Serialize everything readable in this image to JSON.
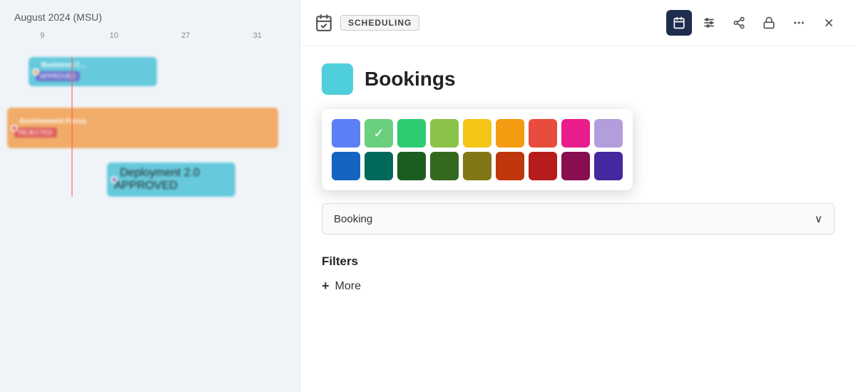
{
  "header": {
    "calendar_icon": "📅",
    "scheduling_label": "SCHEDULING",
    "icons": [
      {
        "name": "calendar-view-icon",
        "symbol": "📅",
        "active": true
      },
      {
        "name": "sliders-icon",
        "symbol": "⚙",
        "active": false
      },
      {
        "name": "share-icon",
        "symbol": "⬡",
        "active": false
      },
      {
        "name": "lock-icon",
        "symbol": "🔒",
        "active": false
      },
      {
        "name": "more-dots-icon",
        "symbol": "•••",
        "active": false
      },
      {
        "name": "close-icon",
        "symbol": "✕",
        "active": false
      }
    ]
  },
  "calendar": {
    "title": "August 2024 (MSU)",
    "col_headers": [
      "9",
      "10",
      "27",
      "31"
    ]
  },
  "bookings_panel": {
    "title": "Bookings",
    "swatch_color": "#4ecfdb",
    "color_rows": [
      [
        {
          "color": "#5b7ff5",
          "selected": false
        },
        {
          "color": "#6bcf80",
          "selected": true
        },
        {
          "color": "#2ecc71",
          "selected": false
        },
        {
          "color": "#8bc34a",
          "selected": false
        },
        {
          "color": "#f5c518",
          "selected": false
        },
        {
          "color": "#f39c12",
          "selected": false
        },
        {
          "color": "#e74c3c",
          "selected": false
        },
        {
          "color": "#e91e8c",
          "selected": false
        },
        {
          "color": "#b39ddb",
          "selected": false
        }
      ],
      [
        {
          "color": "#1565c0",
          "selected": false
        },
        {
          "color": "#00695c",
          "selected": false
        },
        {
          "color": "#1b5e20",
          "selected": false
        },
        {
          "color": "#33691e",
          "selected": false
        },
        {
          "color": "#827717",
          "selected": false
        },
        {
          "color": "#bf360c",
          "selected": false
        },
        {
          "color": "#b71c1c",
          "selected": false
        },
        {
          "color": "#880e4f",
          "selected": false
        },
        {
          "color": "#4527a0",
          "selected": false
        }
      ]
    ],
    "booking_dropdown": {
      "label": "Booking",
      "chevron": "∨"
    },
    "filters_label": "Filters",
    "more_button_label": "More",
    "plus_symbol": "+"
  }
}
